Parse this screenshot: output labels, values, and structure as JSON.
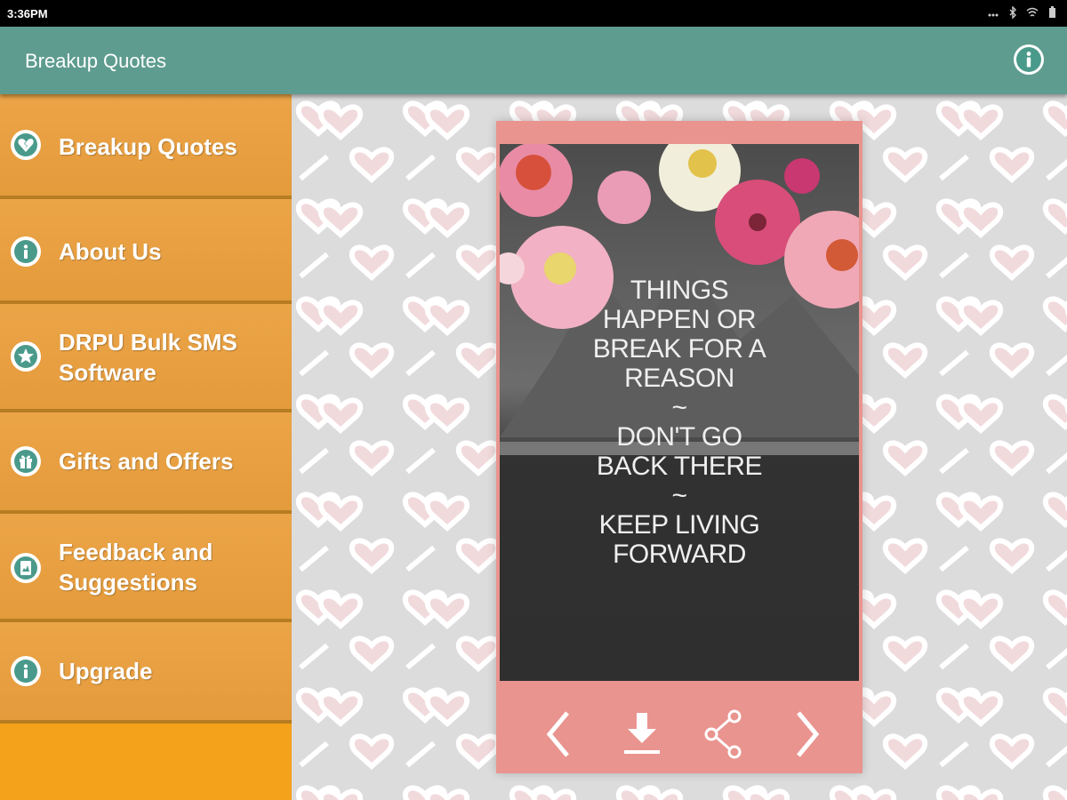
{
  "status_bar": {
    "time": "3:36PM"
  },
  "app_bar": {
    "title": "Breakup Quotes"
  },
  "drawer": {
    "items": [
      {
        "label": "Breakup Quotes",
        "icon": "broken-heart-icon"
      },
      {
        "label": "About Us",
        "icon": "info-icon"
      },
      {
        "label": "DRPU Bulk SMS\nSoftware",
        "icon": "star-icon"
      },
      {
        "label": "Gifts and Offers",
        "icon": "gift-icon"
      },
      {
        "label": "Feedback and\nSuggestions",
        "icon": "feedback-icon"
      },
      {
        "label": "Upgrade",
        "icon": "info-icon"
      }
    ]
  },
  "quote": {
    "lines": [
      "THINGS",
      "HAPPEN OR",
      "BREAK FOR A",
      "REASON",
      "~",
      "DON'T GO",
      "BACK THERE",
      "~",
      "KEEP LIVING",
      "FORWARD"
    ]
  },
  "controls": [
    "previous-icon",
    "download-icon",
    "share-icon",
    "next-icon"
  ],
  "colors": {
    "app_bar": "#5e9c8f",
    "drawer": "#f4a21b",
    "card": "#e9948f",
    "icon_accent": "#4a9a8b"
  }
}
